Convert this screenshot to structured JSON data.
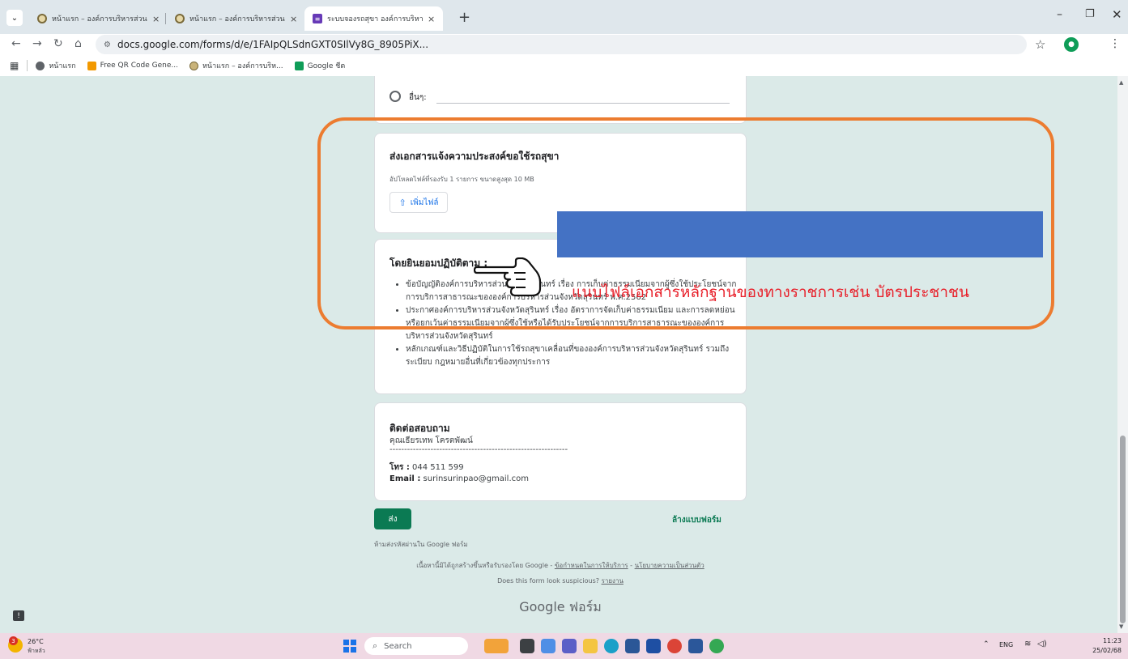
{
  "browser": {
    "tabs": [
      {
        "title": "หน้าแรก – องค์การบริหารส่วนจังหวัด",
        "active": false
      },
      {
        "title": "หน้าแรก – องค์การบริหารส่วนจังหวัด",
        "active": false
      },
      {
        "title": "ระบบจองรถสุขา องค์การบริหารส่วน",
        "active": true
      }
    ],
    "tab_close_glyph": "×",
    "new_tab_glyph": "+",
    "url": "docs.google.com/forms/d/e/1FAIpQLSdnGXT0SIlVy8G_8905PiX...",
    "bookmarks": [
      {
        "label": "หน้าแรก",
        "icon": "globe-icon"
      },
      {
        "label": "Free QR Code Gene...",
        "icon": "qr-icon"
      },
      {
        "label": "หน้าแรก – องค์การบริห...",
        "icon": "pao-icon"
      },
      {
        "label": "Google ชีต",
        "icon": "sheets-icon"
      }
    ]
  },
  "form": {
    "other_option_label": "อื่นๆ:",
    "upload": {
      "title": "ส่งเอกสารแจ้งความประสงค์ขอใช้รถสุขา",
      "hint": "อัปโหลดไฟล์ที่รองรับ 1 รายการ ขนาดสูงสุด 10 MB",
      "button_label": "เพิ่มไฟล์"
    },
    "consent": {
      "title": "โดยยินยอมปฏิบัติตาม :",
      "items": [
        "ข้อบัญญัติองค์การบริหารส่วนจังหวัดสุรินทร์ เรื่อง การเก็บค่าธรรมเนียมจากผู้ซึ่งใช้ประโยชน์จากการบริการสาธารณะขององค์การบริหารส่วนจังหวัดสุรินทร์ พ.ศ.2562",
        "ประกาศองค์การบริหารส่วนจังหวัดสุรินทร์ เรื่อง อัตราการจัดเก็บค่าธรรมเนียม และการลดหย่อนหรือยกเว้นค่าธรรมเนียมจากผู้ซึ่งใช้หรือได้รับประโยชน์จากการบริการสาธารณะขององค์การบริหารส่วนจังหวัดสุรินทร์",
        "หลักเกณฑ์และวิธีปฏิบัติในการใช้รถสุขาเคลื่อนที่ขององค์การบริหารส่วนจังหวัดสุรินทร์ รวมถึงระเบียบ กฎหมายอื่นที่เกี่ยวข้องทุกประการ"
      ]
    },
    "contact": {
      "title": "ติดต่อสอบถาม",
      "name": "คุณเธียรเทพ โครตพัฒน์",
      "divider": "-------------------------------------------------------------",
      "tel_label": "โทร :",
      "tel_value": "044 511 599",
      "email_label": "Email :",
      "email_value": "surinsurinpao@gmail.com"
    },
    "submit_label": "ส่ง",
    "clear_label": "ล้างแบบฟอร์ม",
    "no_password_note": "ห้ามส่งรหัสผ่านใน Google ฟอร์ม",
    "disclaimer_text": "เนื้อหานี้มิได้ถูกสร้างขึ้นหรือรับรองโดย Google - ",
    "terms_link": "ข้อกำหนดในการให้บริการ",
    "privacy_link": "นโยบายความเป็นส่วนตัว",
    "suspicious_text": "Does this form look suspicious? ",
    "report_link": "รายงาน",
    "logo_text": "Google ฟอร์ม"
  },
  "annotation": {
    "text": "แนบไฟล์เอกสารหลักฐานของทางราชการเช่น บัตรประชาชน",
    "frame_color": "#ec7c30",
    "text_color": "#e8202a",
    "redaction_color": "#4472c4"
  },
  "taskbar": {
    "weather_temp": "26°C",
    "weather_desc": "ฟ้าหลัว",
    "weather_badge": "3",
    "search_placeholder": "Search",
    "lang": "ENG",
    "time": "11:23",
    "date": "25/02/68"
  },
  "colors": {
    "page_background": "#dbeae8",
    "accent": "#0b7a53",
    "link": "#1a73e8"
  }
}
